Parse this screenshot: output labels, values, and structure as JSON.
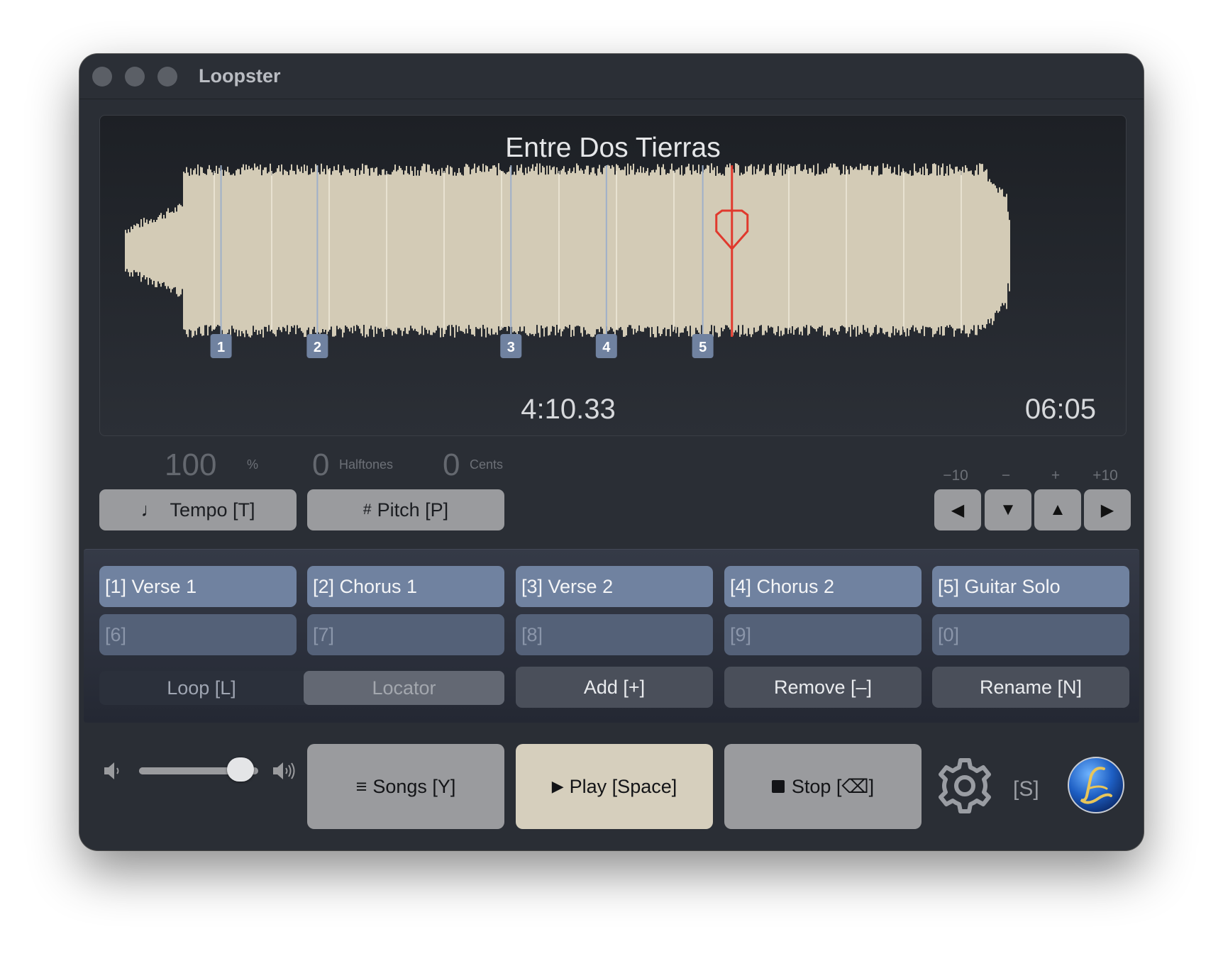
{
  "window": {
    "title": "Loopster"
  },
  "song": {
    "title": "Entre Dos Tierras",
    "position": "4:10.33",
    "duration": "06:05",
    "playhead_fraction": 0.686,
    "markers": [
      {
        "label": "1",
        "fraction": 0.108
      },
      {
        "label": "2",
        "fraction": 0.217
      },
      {
        "label": "3",
        "fraction": 0.436
      },
      {
        "label": "4",
        "fraction": 0.544
      },
      {
        "label": "5",
        "fraction": 0.653
      }
    ]
  },
  "tempo": {
    "value": "100",
    "unit": "%",
    "button": "Tempo [T]"
  },
  "pitch": {
    "halftones": "0",
    "halftones_unit": "Halftones",
    "cents": "0",
    "cents_unit": "Cents",
    "button": "Pitch [P]"
  },
  "stepper": {
    "labels": [
      "−10",
      "−",
      "+",
      "+10"
    ]
  },
  "sections": [
    "[1] Verse 1",
    "[2] Chorus 1",
    "[3] Verse 2",
    "[4] Chorus 2",
    "[5] Guitar Solo",
    "[6]",
    "[7]",
    "[8]",
    "[9]",
    "[0]"
  ],
  "mode": {
    "loop": "Loop [L]",
    "locator": "Locator",
    "selected": "Locator"
  },
  "actions": {
    "add": "Add [+]",
    "remove": "Remove [–]",
    "rename": "Rename [N]"
  },
  "volume": {
    "level": 0.85
  },
  "transport": {
    "songs": "Songs [Y]",
    "play": "Play [Space]",
    "stop": "Stop [⌫]"
  },
  "settings": {
    "shortcut": "[S]"
  },
  "colors": {
    "playhead": "#e0392d",
    "waveform": "#d3cbb6",
    "section_active": "#7082a0",
    "play_button": "#d6cfbd"
  }
}
